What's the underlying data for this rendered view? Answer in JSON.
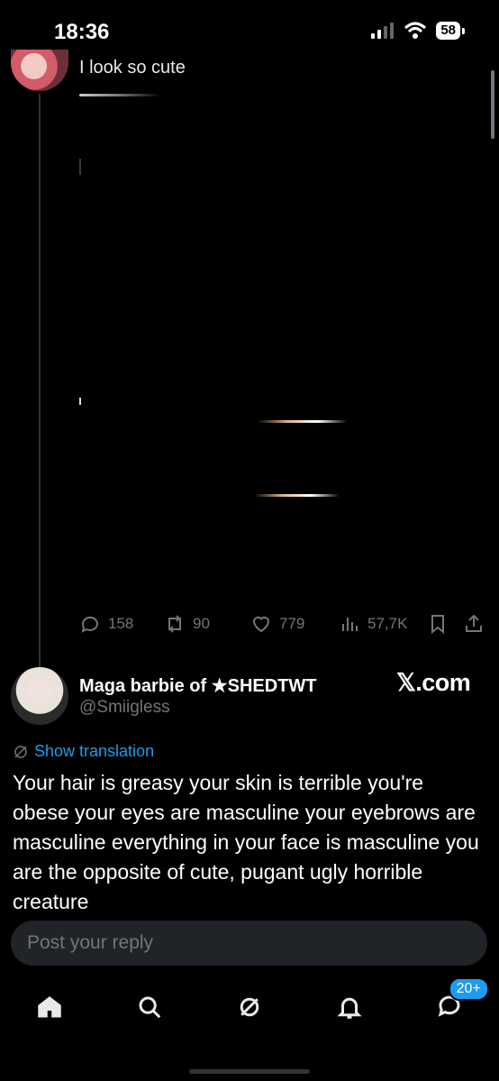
{
  "status_bar": {
    "time": "18:36",
    "battery": "58"
  },
  "tweet": {
    "text": "I look so cute"
  },
  "actions": {
    "replies": "158",
    "reposts": "90",
    "likes": "779",
    "views": "57,7K"
  },
  "reply": {
    "name": "Maga barbie of ★SHEDTWT",
    "handle": "@Smiigless",
    "watermark": "𝕏.com",
    "show_translation": "Show translation",
    "text": "Your hair is greasy your skin is terrible you're obese your eyes are masculine your eyebrows are masculine everything in your face is masculine you are the opposite of cute, pugant ugly horrible creature"
  },
  "reply_input": {
    "placeholder": "Post your reply"
  },
  "nav": {
    "messages_badge": "20+"
  }
}
